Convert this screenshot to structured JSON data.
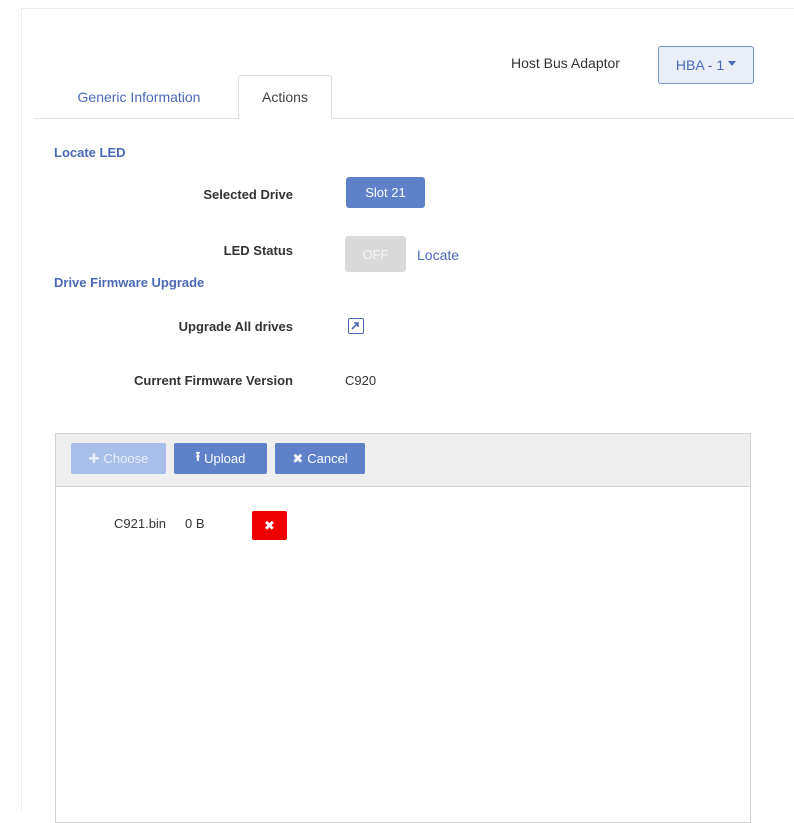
{
  "header": {
    "hba_label": "Host Bus Adaptor",
    "hba_selected": "HBA - 1"
  },
  "tabs": [
    {
      "label": "Generic Information",
      "active": false
    },
    {
      "label": "Actions",
      "active": true
    }
  ],
  "locate_led": {
    "title": "Locate LED",
    "selected_drive_label": "Selected Drive",
    "selected_drive_value": "Slot 21",
    "led_status_label": "LED Status",
    "led_status_value": "OFF",
    "locate_link": "Locate"
  },
  "firmware": {
    "title": "Drive Firmware Upgrade",
    "upgrade_all_label": "Upgrade All drives",
    "upgrade_icon": "external-link-icon",
    "current_version_label": "Current Firmware Version",
    "current_version_value": "C920"
  },
  "uploader": {
    "choose_label": "Choose",
    "upload_label": "Upload",
    "cancel_label": "Cancel",
    "files": [
      {
        "name": "C921.bin",
        "size": "0 B"
      }
    ]
  },
  "colors": {
    "accent": "#5e81c9",
    "link": "#4a69b5",
    "danger": "#ee0000"
  }
}
